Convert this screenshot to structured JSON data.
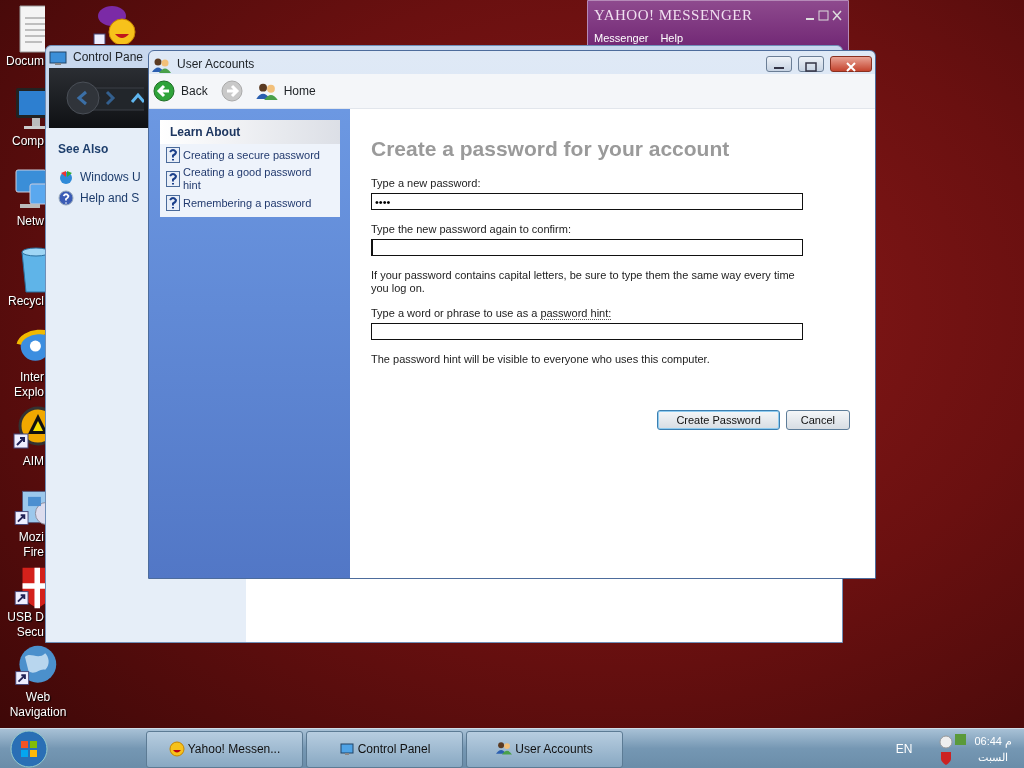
{
  "desktop_icons": [
    {
      "label": "Docum",
      "kind": "document",
      "shortcut": false
    },
    {
      "label": "Comp",
      "kind": "monitor",
      "shortcut": false
    },
    {
      "label": "Netw",
      "kind": "network",
      "shortcut": false
    },
    {
      "label": "Recycl",
      "kind": "bin",
      "shortcut": false
    },
    {
      "label": "Inter Explo",
      "kind": "browser",
      "shortcut": false
    },
    {
      "label": "AIM",
      "kind": "player",
      "shortcut": true
    },
    {
      "label": "Mozi Fire",
      "kind": "box",
      "shortcut": true
    },
    {
      "label": "USB D Secu",
      "kind": "shield",
      "shortcut": true
    },
    {
      "label": "Web Navigation",
      "kind": "globe",
      "shortcut": true
    }
  ],
  "yahoo_window": {
    "title": "YAHOO! MESSENGER",
    "menu": [
      "Messenger",
      "Help"
    ]
  },
  "control_panel": {
    "title": "Control Pane",
    "see_also": {
      "heading": "See Also",
      "items": [
        "Windows U",
        "Help and S"
      ]
    }
  },
  "user_accounts": {
    "title": "User Accounts",
    "toolbar": {
      "back": "Back",
      "home": "Home"
    },
    "learn_about": {
      "heading": "Learn About",
      "links": [
        "Creating a secure password",
        "Creating a good password hint",
        "Remembering a password"
      ]
    },
    "heading": "Create a password for your account",
    "fields": [
      {
        "label": "Type a new password:",
        "value": "••••",
        "focused": false
      },
      {
        "label": "Type the new password again to confirm:",
        "focused": true
      }
    ],
    "note": "If your password contains capital letters, be sure to type them the same way every time you log on.",
    "hint_field": {
      "label": "Type a word or phrase to use as a",
      "link": "password hint:"
    },
    "hint_note": "The password hint will be visible to everyone who uses this computer.",
    "buttons": [
      "Create Password",
      "Cancel"
    ]
  },
  "taskbar": {
    "tasks": [
      {
        "label": "Yahoo! Messen...",
        "kind": "smiley"
      },
      {
        "label": "Control Panel",
        "kind": "panel"
      },
      {
        "label": "User Accounts",
        "kind": "users"
      }
    ],
    "language": "EN",
    "time": "06:44 م",
    "day": "السبت"
  }
}
